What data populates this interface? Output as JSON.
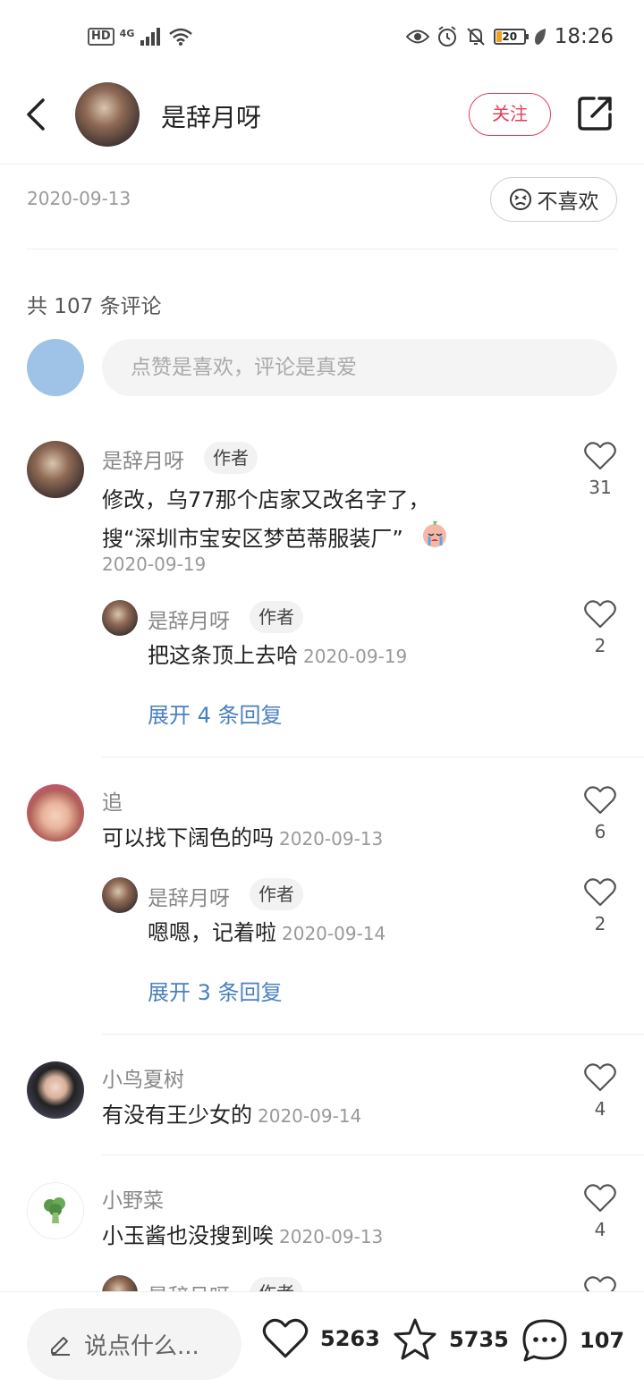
{
  "status_bar": {
    "hd": "HD",
    "network": "4G",
    "battery": "20",
    "time": "18:26"
  },
  "header": {
    "author_name": "是辞月呀",
    "follow_label": "关注"
  },
  "post": {
    "date": "2020-09-13",
    "dislike_label": "不喜欢"
  },
  "comments_section": {
    "count_label": "共 107 条评论",
    "input_placeholder": "点赞是喜欢，评论是真爱"
  },
  "comments": [
    {
      "name": "是辞月呀",
      "badge": "作者",
      "text_line1": "修改，乌77那个店家又改名字了，",
      "text_line2": "搜“深圳市宝安区梦芭蒂服装厂”",
      "date": "2020-09-19",
      "likes": "31",
      "reply": {
        "name": "是辞月呀",
        "badge": "作者",
        "text": "把这条顶上去哈",
        "date": "2020-09-19",
        "likes": "2"
      },
      "expand_label": "展开 4 条回复"
    },
    {
      "name": "追",
      "text": "可以找下阔色的吗",
      "date": "2020-09-13",
      "likes": "6",
      "reply": {
        "name": "是辞月呀",
        "badge": "作者",
        "text": "嗯嗯，记着啦",
        "date": "2020-09-14",
        "likes": "2"
      },
      "expand_label": "展开 3 条回复"
    },
    {
      "name": "小鸟夏树",
      "text": "有没有王少女的",
      "date": "2020-09-14",
      "likes": "4"
    },
    {
      "name": "小野菜",
      "text": "小玉酱也没搜到唉",
      "date": "2020-09-13",
      "likes": "4"
    },
    {
      "name": "是辞月呀",
      "badge": "作者"
    }
  ],
  "bottom_bar": {
    "say_placeholder": "说点什么...",
    "likes": "5263",
    "favorites": "5735",
    "comments": "107"
  },
  "colors": {
    "accent_red": "#e0405a",
    "link_blue": "#4a80c0",
    "my_avatar": "#9ec3e6"
  }
}
